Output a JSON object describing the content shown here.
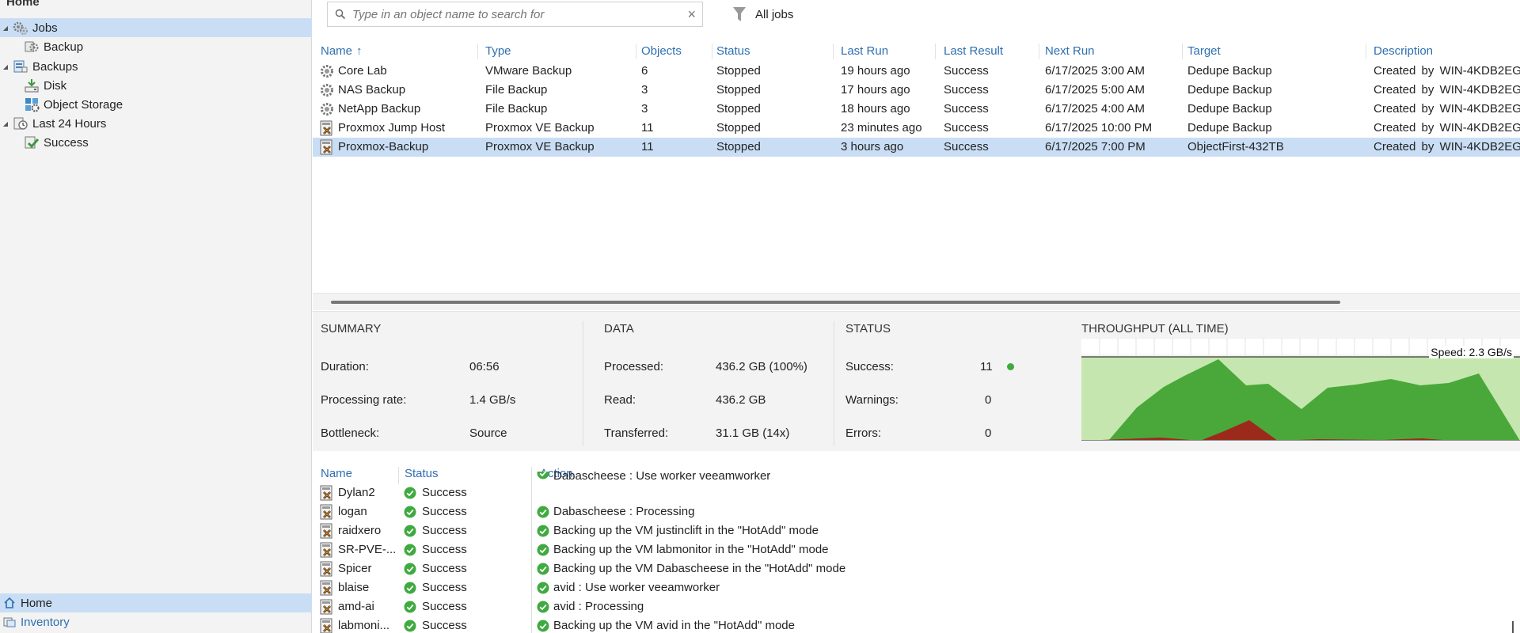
{
  "nav": {
    "title": "Home",
    "tree": [
      {
        "label": "Jobs",
        "icon": "gears-icon",
        "expanded": true,
        "selected": true
      },
      {
        "label": "Backup",
        "icon": "backup-job-icon"
      },
      {
        "label": "Backups",
        "icon": "backups-icon",
        "expanded": true
      },
      {
        "label": "Disk",
        "icon": "disk-icon"
      },
      {
        "label": "Object Storage",
        "icon": "object-storage-icon"
      },
      {
        "label": "Last 24 Hours",
        "icon": "last-24-hours-icon",
        "expanded": true
      },
      {
        "label": "Success",
        "icon": "success-icon"
      }
    ],
    "bottom": [
      {
        "label": "Home",
        "icon": "home-icon",
        "selected": true
      },
      {
        "label": "Inventory",
        "icon": "inventory-icon"
      }
    ]
  },
  "search": {
    "placeholder": "Type in an object name to search for",
    "value": ""
  },
  "filter": {
    "label": "All jobs"
  },
  "jobs": {
    "columns": [
      "Name",
      "Type",
      "Objects",
      "Status",
      "Last Run",
      "Last Result",
      "Next Run",
      "Target",
      "Description"
    ],
    "sort_column": "Name",
    "rows": [
      {
        "name": "Core Lab",
        "type": "VMware Backup",
        "objects": "6",
        "status": "Stopped",
        "last_run": "19 hours ago",
        "last_result": "Success",
        "next_run": "6/17/2025 3:00 AM",
        "target": "Dedupe Backup",
        "description": "Created by WIN-4KDB2EG",
        "icon": "gear-job-icon"
      },
      {
        "name": "NAS Backup",
        "type": "File Backup",
        "objects": "3",
        "status": "Stopped",
        "last_run": "17 hours ago",
        "last_result": "Success",
        "next_run": "6/17/2025 5:00 AM",
        "target": "Dedupe Backup",
        "description": "Created by WIN-4KDB2EG",
        "icon": "gear-job-icon"
      },
      {
        "name": "NetApp Backup",
        "type": "File Backup",
        "objects": "3",
        "status": "Stopped",
        "last_run": "18 hours ago",
        "last_result": "Success",
        "next_run": "6/17/2025 4:00 AM",
        "target": "Dedupe Backup",
        "description": "Created by WIN-4KDB2EG",
        "icon": "gear-job-icon"
      },
      {
        "name": "Proxmox Jump Host",
        "type": "Proxmox VE Backup",
        "objects": "11",
        "status": "Stopped",
        "last_run": "23 minutes ago",
        "last_result": "Success",
        "next_run": "6/17/2025 10:00 PM",
        "target": "Dedupe Backup",
        "description": "Created by WIN-4KDB2EG",
        "icon": "proxmox-job-icon"
      },
      {
        "name": "Proxmox-Backup",
        "type": "Proxmox VE Backup",
        "objects": "11",
        "status": "Stopped",
        "last_run": "3 hours ago",
        "last_result": "Success",
        "next_run": "6/17/2025 7:00 PM",
        "target": "ObjectFirst-432TB",
        "description": "Created by WIN-4KDB2EG",
        "icon": "proxmox-job-icon",
        "selected": true
      }
    ]
  },
  "summary": {
    "title": "SUMMARY",
    "duration_label": "Duration:",
    "duration": "06:56",
    "rate_label": "Processing rate:",
    "rate": "1.4 GB/s",
    "bottleneck_label": "Bottleneck:",
    "bottleneck": "Source"
  },
  "data_section": {
    "title": "DATA",
    "processed_label": "Processed:",
    "processed": "436.2 GB (100%)",
    "read_label": "Read:",
    "read": "436.2 GB",
    "transferred_label": "Transferred:",
    "transferred": "31.1 GB (14x)"
  },
  "status_section": {
    "title": "STATUS",
    "success_label": "Success:",
    "success": "11",
    "warnings_label": "Warnings:",
    "warnings": "0",
    "errors_label": "Errors:",
    "errors": "0"
  },
  "throughput": {
    "title": "THROUGHPUT (ALL TIME)",
    "speed": "Speed: 2.3 GB/s",
    "colors": {
      "background": "#c6e6b0",
      "processing": "#4aa83b",
      "read": "#9c2a1a"
    }
  },
  "session": {
    "columns": [
      "Name",
      "Status",
      "Action"
    ],
    "items": [
      {
        "name": "Dylan2",
        "status": "Success"
      },
      {
        "name": "logan",
        "status": "Success"
      },
      {
        "name": "raidxero",
        "status": "Success"
      },
      {
        "name": "SR-PVE-...",
        "status": "Success"
      },
      {
        "name": "Spicer",
        "status": "Success"
      },
      {
        "name": "blaise",
        "status": "Success"
      },
      {
        "name": "amd-ai",
        "status": "Success"
      },
      {
        "name": "labmoni...",
        "status": "Success"
      }
    ],
    "actions": [
      "Dabascheese : Use worker veeamworker",
      "Dabascheese : Processing",
      "Backing up the VM justinclift in the \"HotAdd\" mode",
      "Backing up the VM labmonitor in the \"HotAdd\" mode",
      "Backing up the VM Dabascheese in the \"HotAdd\" mode",
      "avid : Use worker veeamworker",
      "avid : Processing",
      "Backing up the VM avid in the \"HotAdd\" mode"
    ]
  }
}
